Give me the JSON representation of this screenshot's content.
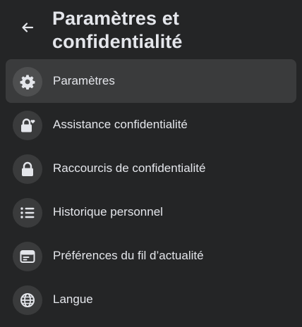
{
  "header": {
    "back_icon": "arrow-left-icon",
    "title": "Paramètres et confidentialité"
  },
  "menu": {
    "items": [
      {
        "label": "Paramètres",
        "icon": "gear-icon",
        "active": true
      },
      {
        "label": "Assistance confidentialité",
        "icon": "lock-heart-icon",
        "active": false
      },
      {
        "label": "Raccourcis de confidentialité",
        "icon": "lock-icon",
        "active": false
      },
      {
        "label": "Historique personnel",
        "icon": "list-icon",
        "active": false
      },
      {
        "label": "Préférences du fil d’actualité",
        "icon": "feed-card-icon",
        "active": false
      },
      {
        "label": "Langue",
        "icon": "globe-icon",
        "active": false
      }
    ]
  },
  "colors": {
    "background": "#242526",
    "active_row": "#3a3b3c",
    "icon_circle": "#3a3b3c",
    "text": "#e4e6eb"
  }
}
